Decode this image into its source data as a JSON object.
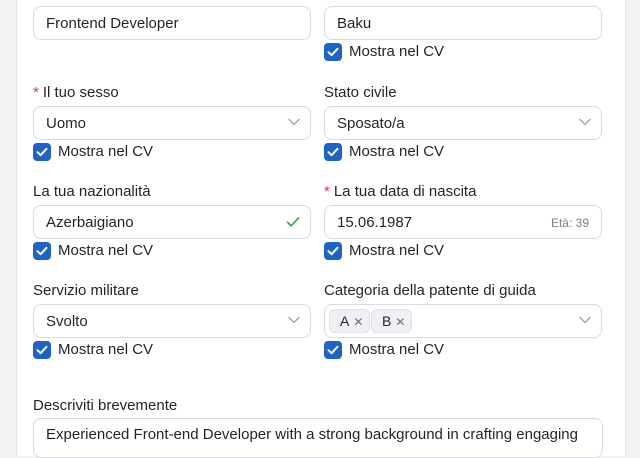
{
  "job_title": {
    "value": "Frontend Developer"
  },
  "city": {
    "value": "Baku",
    "show_in_cv": "Mostra nel CV"
  },
  "gender": {
    "label": "Il tuo sesso",
    "required": "*",
    "value": "Uomo",
    "show_in_cv": "Mostra nel CV"
  },
  "marital_status": {
    "label": "Stato civile",
    "value": "Sposato/a",
    "show_in_cv": "Mostra nel CV"
  },
  "nationality": {
    "label": "La tua nazionalità",
    "value": "Azerbaigiano",
    "show_in_cv": "Mostra nel CV"
  },
  "birth_date": {
    "label": "La tua data di nascita",
    "required": "*",
    "value": "15.06.1987",
    "age": "Età: 39",
    "show_in_cv": "Mostra nel CV"
  },
  "military_service": {
    "label": "Servizio militare",
    "value": "Svolto",
    "show_in_cv": "Mostra nel CV"
  },
  "license": {
    "label": "Categoria della patente di guida",
    "tags": [
      "A",
      "B"
    ],
    "show_in_cv": "Mostra nel CV"
  },
  "description": {
    "label": "Descriviti brevemente",
    "value": "Experienced Front-end Developer with a strong background in crafting engaging"
  },
  "colors": {
    "accent": "#1f63c6",
    "required": "#e0364b",
    "valid": "#2f9e44"
  }
}
